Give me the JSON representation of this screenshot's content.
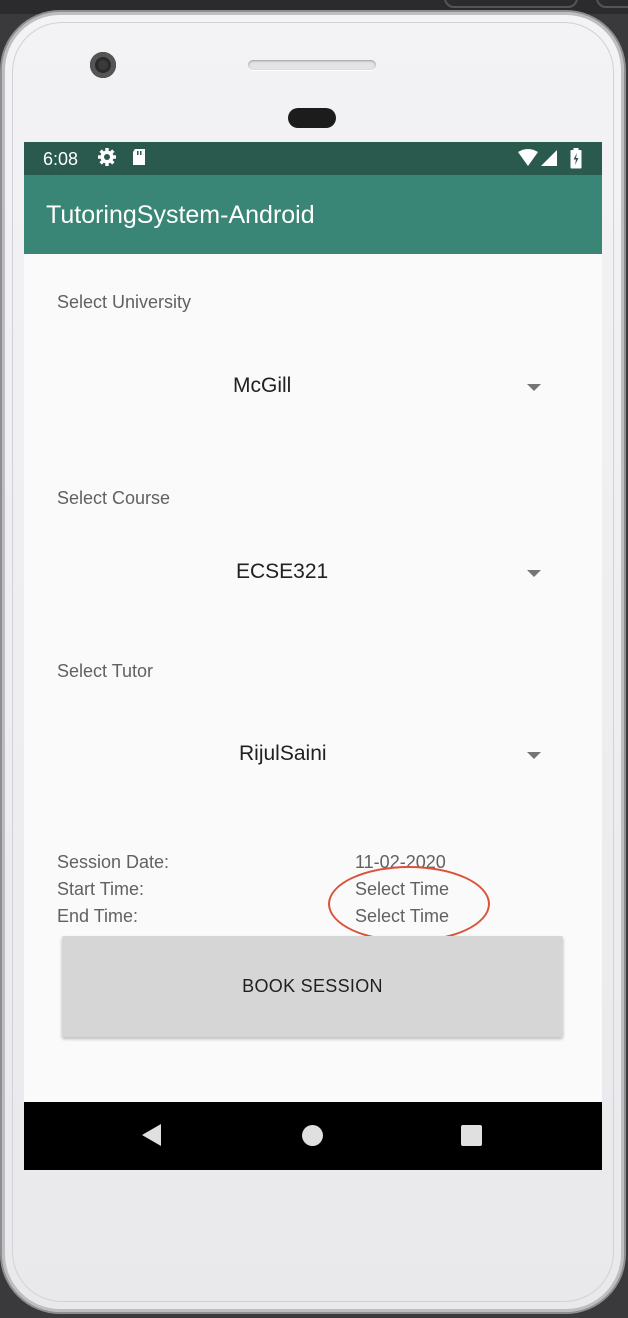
{
  "status_bar": {
    "time": "6:08"
  },
  "app_bar": {
    "title": "TutoringSystem-Android"
  },
  "form": {
    "university": {
      "label": "Select University",
      "value": "McGill"
    },
    "course": {
      "label": "Select Course",
      "value": "ECSE321"
    },
    "tutor": {
      "label": "Select Tutor",
      "value": "RijulSaini"
    },
    "session_date": {
      "label": "Session Date:",
      "value": "11-02-2020"
    },
    "start_time": {
      "label": "Start Time:",
      "value": "Select Time"
    },
    "end_time": {
      "label": "End Time:",
      "value": "Select Time"
    },
    "book_button": "BOOK SESSION"
  },
  "colors": {
    "status_bar": "#2a5a4d",
    "app_bar": "#398676",
    "annotation": "#d9533a"
  },
  "icons": [
    "settings-icon",
    "sd-card-icon",
    "wifi-icon",
    "signal-icon",
    "battery-icon",
    "back-icon",
    "home-icon",
    "recents-icon"
  ]
}
